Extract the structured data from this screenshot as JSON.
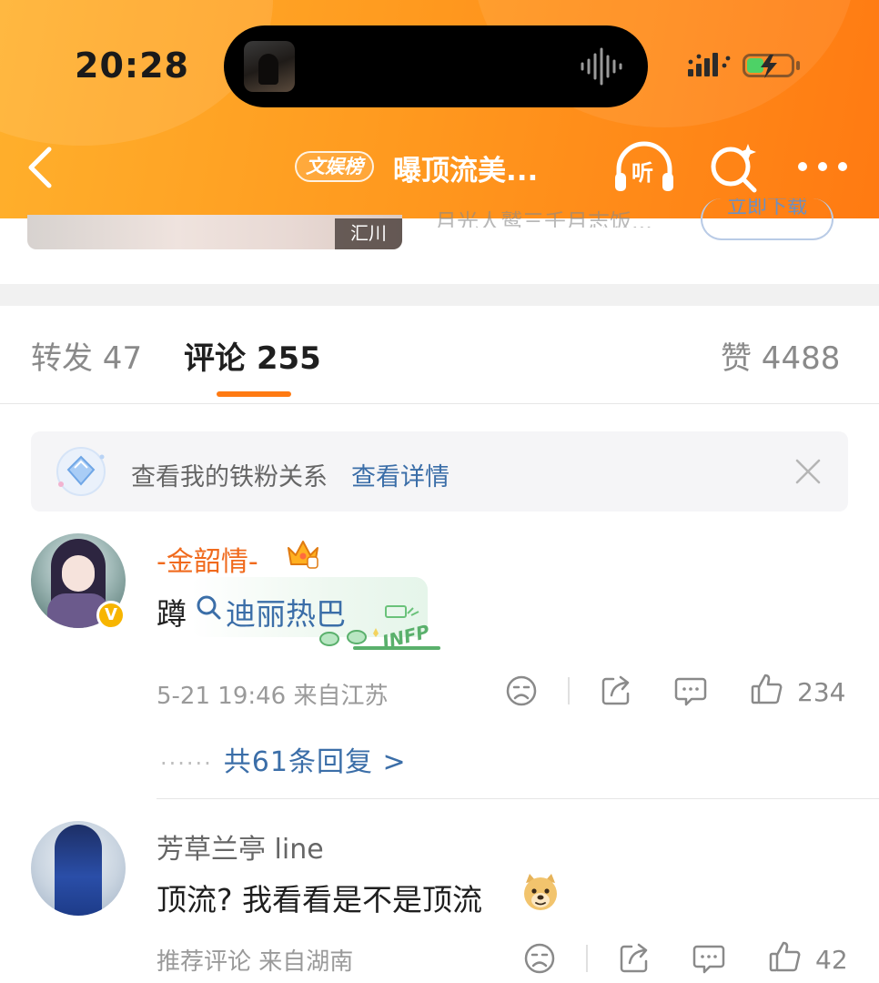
{
  "status_bar": {
    "time": "20:28"
  },
  "nav": {
    "tag": "文娱榜",
    "title": "曝顶流美...",
    "listen_label": "听"
  },
  "card": {
    "thumb_label": "汇川",
    "cut_text": "月光人鹫三千月志饭...",
    "download_label": "立即下载"
  },
  "tabs": [
    {
      "label": "转发 47"
    },
    {
      "label": "评论 255"
    },
    {
      "label": "赞 4488"
    }
  ],
  "fan_banner": {
    "text": "查看我的铁粉关系",
    "link": "查看详情"
  },
  "comments": [
    {
      "username": "-金韶情-",
      "text_prefix": "蹲",
      "topic": "迪丽热巴",
      "meta": "5-21 19:46  来自江苏",
      "likes": "234",
      "reply_dots": "······",
      "replies": "共61条回复 >"
    },
    {
      "username": "芳草兰亭 line",
      "text": "顶流? 我看看是不是顶流",
      "meta": "推荐评论  来自湖南",
      "likes": "42"
    }
  ],
  "colors": {
    "header_gradient": [
      "#ffb02c",
      "#ff7a12"
    ],
    "accent": "#ff7a12",
    "link": "#3b6ea8",
    "username_vip": "#f06a1d"
  },
  "icons": [
    "back-arrow-icon",
    "listen-headphone-icon",
    "ai-search-icon",
    "more-dots-icon",
    "close-icon",
    "crown-icon",
    "search-icon",
    "dislike-icon",
    "share-icon",
    "comment-icon",
    "like-icon",
    "doge-emoji-icon"
  ]
}
